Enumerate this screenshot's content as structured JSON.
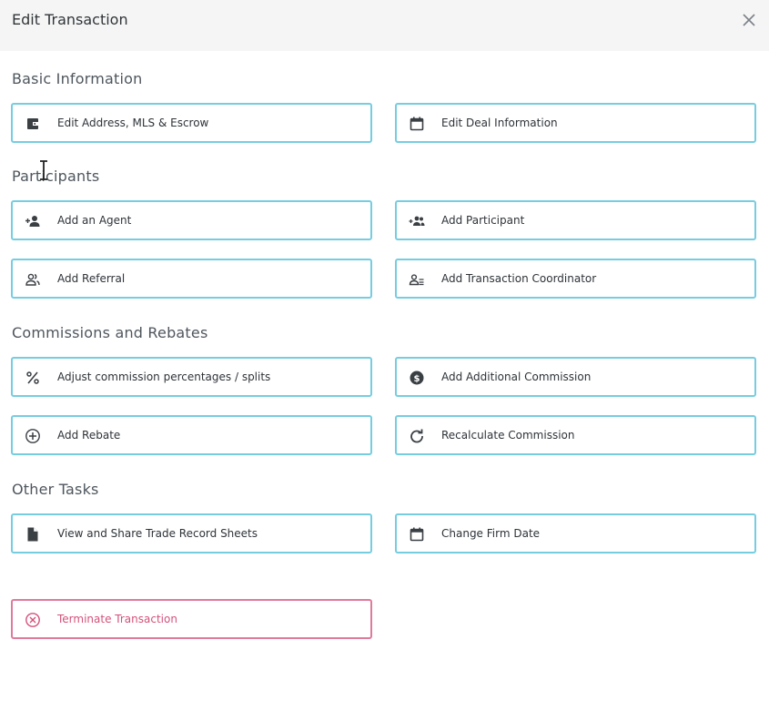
{
  "dialog": {
    "title": "Edit Transaction"
  },
  "sections": {
    "basic": {
      "title": "Basic Information",
      "items": [
        {
          "label": "Edit Address, MLS & Escrow",
          "icon": "wallet-icon"
        },
        {
          "label": "Edit Deal Information",
          "icon": "calendar-icon"
        }
      ]
    },
    "participants": {
      "title": "Participants",
      "items": [
        {
          "label": "Add an Agent",
          "icon": "person-add-icon"
        },
        {
          "label": "Add Participant",
          "icon": "group-add-icon"
        },
        {
          "label": "Add Referral",
          "icon": "people-outline-icon"
        },
        {
          "label": "Add Transaction Coordinator",
          "icon": "coordinator-icon"
        }
      ]
    },
    "commissions": {
      "title": "Commissions and Rebates",
      "items": [
        {
          "label": "Adjust commission percentages / splits",
          "icon": "percent-icon"
        },
        {
          "label": "Add Additional Commission",
          "icon": "dollar-circle-icon"
        },
        {
          "label": "Add Rebate",
          "icon": "plus-circle-icon"
        },
        {
          "label": "Recalculate Commission",
          "icon": "refresh-icon"
        }
      ]
    },
    "other": {
      "title": "Other Tasks",
      "items": [
        {
          "label": "View and Share Trade Record Sheets",
          "icon": "document-icon"
        },
        {
          "label": "Change Firm Date",
          "icon": "calendar-icon"
        }
      ]
    }
  },
  "danger": {
    "label": "Terminate Transaction",
    "icon": "cancel-circle-icon"
  },
  "colors": {
    "border": "#76cde0",
    "danger": "#e07a9a",
    "danger_text": "#d4517a",
    "header_bg": "#f5f5f5"
  }
}
